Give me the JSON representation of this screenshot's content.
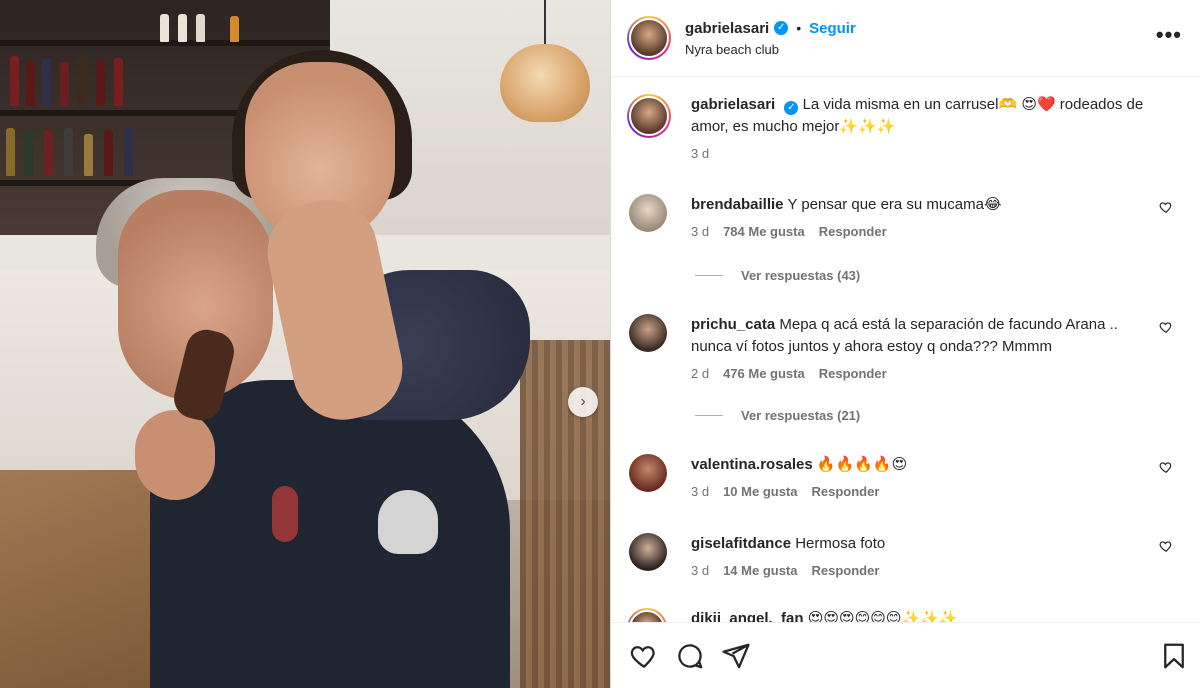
{
  "post": {
    "author": "gabrielasari",
    "follow_label": "Seguir",
    "dot": "•",
    "location": "Nyra beach club",
    "more_label": "•••",
    "next_label": "›"
  },
  "caption": {
    "author": "gabrielasari",
    "text": "La vida misma en un carrusel🫶 😍❤️ rodeados de amor, es mucho mejor✨✨✨",
    "time": "3 d"
  },
  "comments": [
    {
      "user": "brendabaillie",
      "text": "Y pensar que era su mucama😂",
      "time": "3 d",
      "likes": "784 Me gusta",
      "reply": "Responder",
      "view_replies": "Ver respuestas (43)"
    },
    {
      "user": "prichu_cata",
      "text": "Mepa q acá está la separación de facundo Arana .. nunca ví fotos juntos y ahora estoy q onda??? Mmmm",
      "time": "2 d",
      "likes": "476 Me gusta",
      "reply": "Responder",
      "view_replies": "Ver respuestas (21)"
    },
    {
      "user": "valentina.rosales",
      "text": "🔥🔥🔥🔥😍",
      "time": "3 d",
      "likes": "10 Me gusta",
      "reply": "Responder"
    },
    {
      "user": "giselafitdance",
      "text": "Hermosa foto",
      "time": "3 d",
      "likes": "14 Me gusta",
      "reply": "Responder"
    },
    {
      "user": "dikii_angel._fan",
      "text": "😍😍😍😊😊😊✨✨✨"
    }
  ],
  "icons": {
    "like": "heart-icon",
    "comment": "comment-icon",
    "share": "share-icon",
    "save": "bookmark-icon",
    "comment_like": "heart-icon"
  },
  "colors": {
    "accent": "#0095f6",
    "text": "#262626",
    "muted": "#737373"
  }
}
